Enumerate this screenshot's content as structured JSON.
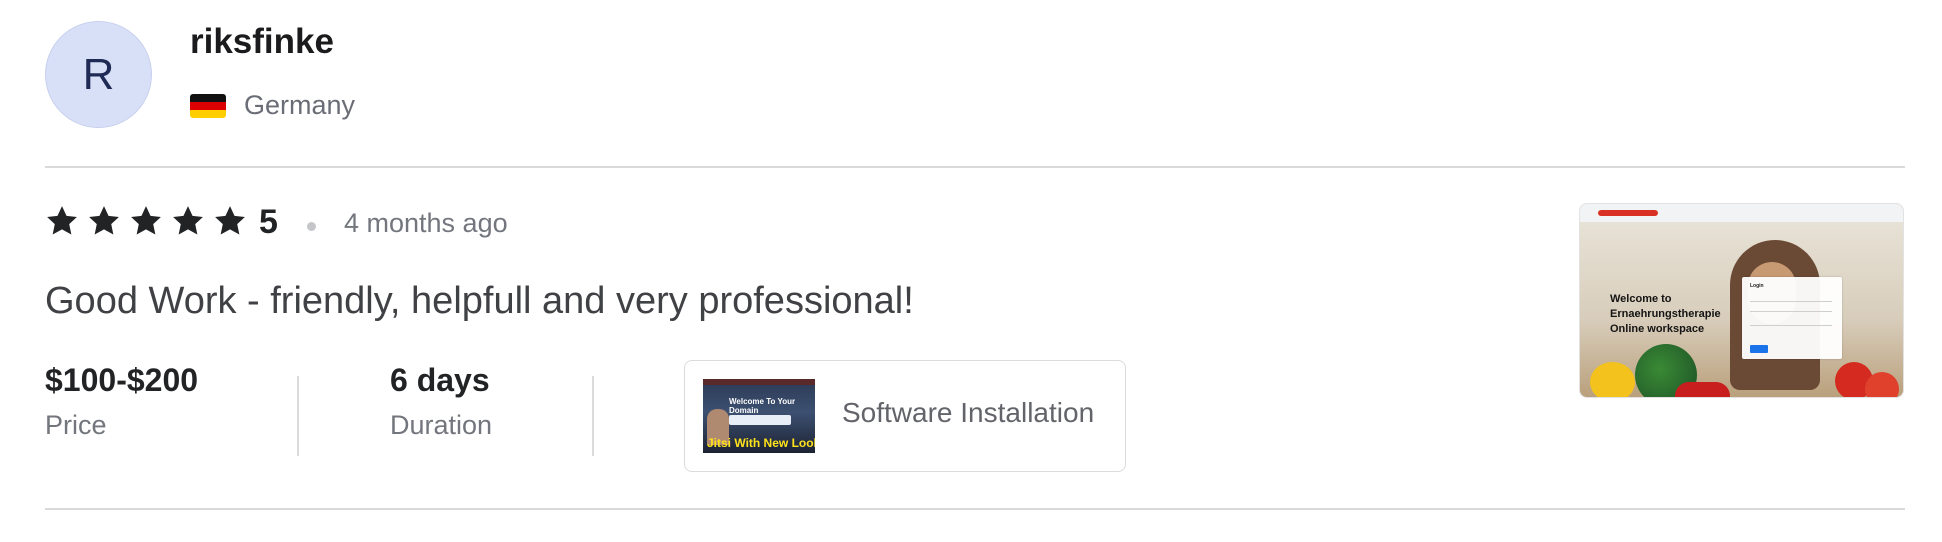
{
  "reviewer": {
    "avatar_initial": "R",
    "username": "riksfinke",
    "country": "Germany",
    "flag_icon": "germany-flag-icon"
  },
  "review": {
    "stars": 5,
    "rating_label": "5",
    "time_ago": "4 months ago",
    "text": "Good Work - friendly, helpfull and very professional!"
  },
  "meta": {
    "price_value": "$100-$200",
    "price_label": "Price",
    "duration_value": "6 days",
    "duration_label": "Duration"
  },
  "gig": {
    "title": "Software Installation",
    "thumbnail_caption": "Jitsi With New Look",
    "thumbnail_heading": "Welcome To Your Domain"
  },
  "delivery_preview": {
    "welcome_text": "Welcome to Ernaehrungstherapie Online workspace",
    "login_title": "Login"
  },
  "colors": {
    "star": "#222325",
    "avatar_bg": "#d8e0f8",
    "divider": "#d9dadc"
  }
}
